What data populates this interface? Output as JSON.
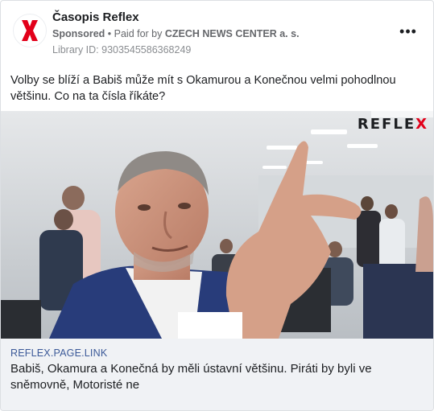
{
  "header": {
    "page_name": "Časopis Reflex",
    "sponsored_label": "Sponsored",
    "separator": " • ",
    "paid_prefix": "Paid for by ",
    "advertiser": "CZECH NEWS CENTER a. s.",
    "library_id": "Library ID: 9303545586368249",
    "more_options_icon": "more-horizontal-icon",
    "avatar_logo_icon": "reflex-x-logo",
    "more_label": "•••"
  },
  "post": {
    "text": "Volby se blíží a Babiš může mít s Okamurou a Konečnou velmi pohodlnou většinu. Co na ta čísla říkáte?"
  },
  "media": {
    "watermark_prefix": "REFLE",
    "watermark_x": "X"
  },
  "link": {
    "domain": "REFLEX.PAGE.LINK",
    "title": "Babiš, Okamura a Konečná by měli ústavní většinu. Piráti by byli ve sněmovně, Motoristé ne"
  },
  "colors": {
    "brand_red": "#e2001a",
    "link_blue": "#3b5998",
    "link_bg": "#f0f2f5",
    "meta_gray": "#65676b"
  }
}
